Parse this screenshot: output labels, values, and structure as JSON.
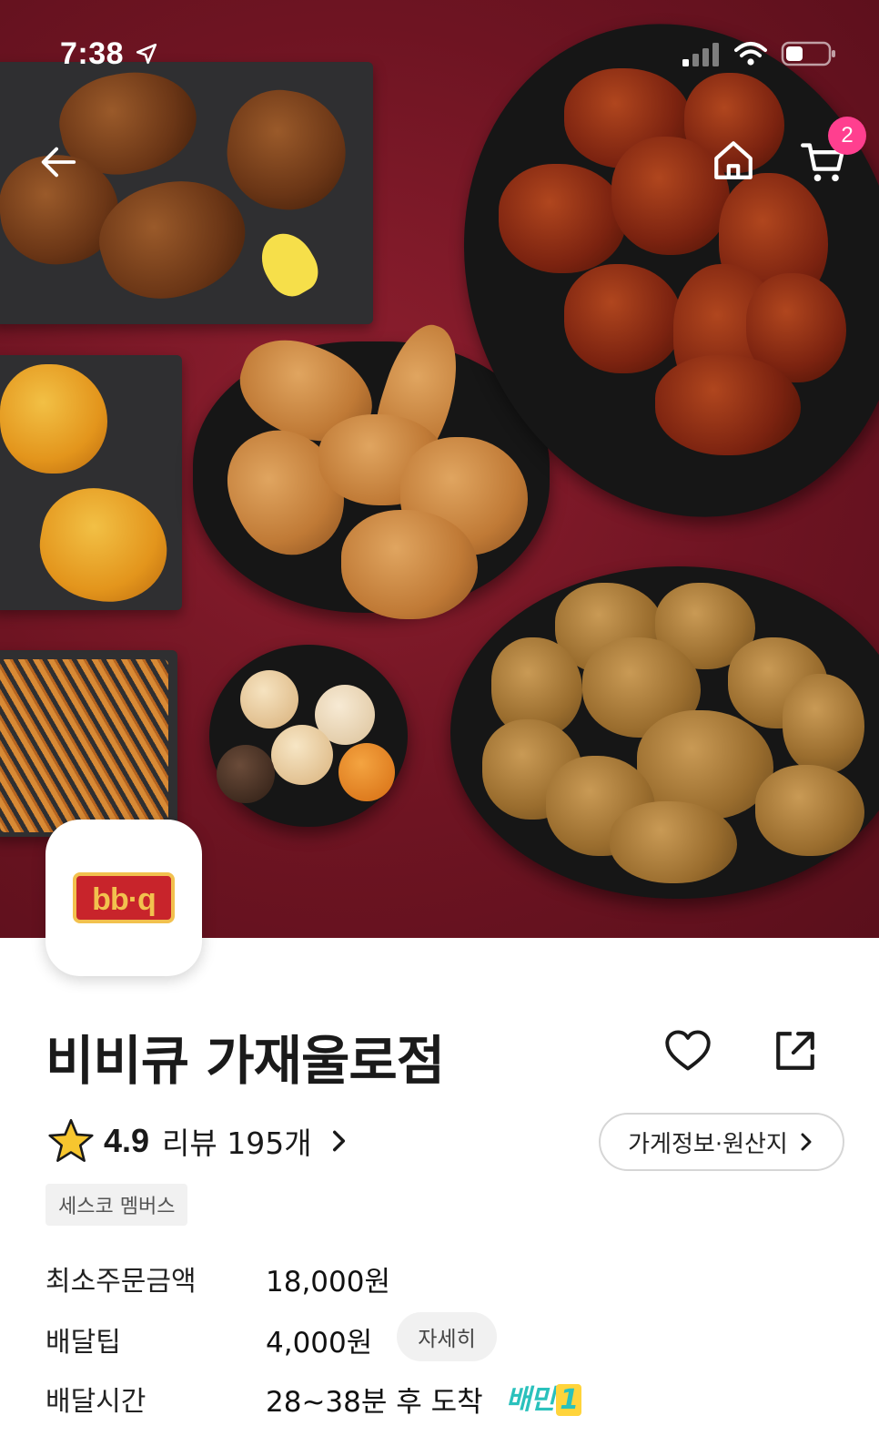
{
  "status_bar": {
    "time": "7:38",
    "icons": [
      "location-arrow-icon",
      "cellular-signal-icon",
      "wifi-icon",
      "battery-icon"
    ]
  },
  "header": {
    "back_icon": "arrow-left-icon",
    "home_icon": "home-icon",
    "cart_icon": "cart-icon",
    "cart_badge": "2"
  },
  "store": {
    "logo_text": "bb·q",
    "name": "비비큐 가재울로점",
    "favorite_icon": "heart-outline-icon",
    "share_icon": "share-icon",
    "rating_icon": "star-icon",
    "rating": "4.9",
    "review_label": "리뷰 195개",
    "review_chevron": "chevron-right-icon",
    "info_button_label": "가게정보·원산지",
    "tag": "세스코 멤버스"
  },
  "details": {
    "min_order_label": "최소주문금액",
    "min_order_value": "18,000원",
    "delivery_tip_label": "배달팁",
    "delivery_tip_value": "4,000원",
    "delivery_tip_more": "자세히",
    "delivery_time_label": "배달시간",
    "delivery_time_value": "28~38분 후 도착",
    "service_badge_text": "배민",
    "service_badge_num": "1"
  },
  "colors": {
    "hero_background": "#7a1626",
    "cart_badge": "#ff3f8f",
    "logo_red": "#c8242b",
    "logo_gold": "#f2c14e",
    "baemin_mint": "#2ac1bc",
    "star": "#f7c62f"
  }
}
